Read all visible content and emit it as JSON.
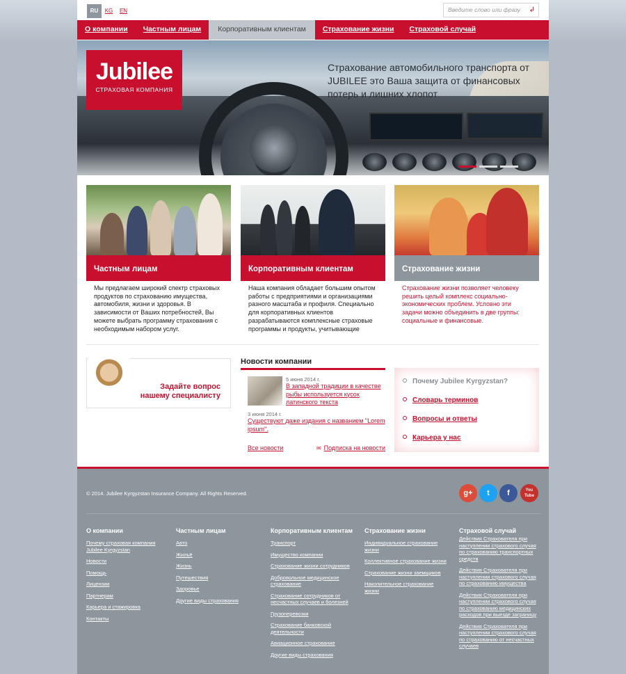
{
  "lang": {
    "ru": "RU",
    "kg": "KG",
    "en": "EN"
  },
  "search": {
    "placeholder": "Введите слово или фразу",
    "go": "↲"
  },
  "nav": [
    "О компании",
    "Частным лицам",
    "Корпоративным клиентам",
    "Страхование жизни",
    "Страховой случай"
  ],
  "banner": {
    "logo_word": "Jubilee",
    "logo_sub": "СТРАХОВАЯ КОМПАНИЯ",
    "slogan": "Страхование автомобильного транспорта от JUBILEE это Ваша защита от финансовых потерь и лишних хлопот"
  },
  "cards": [
    {
      "title": "Частным лицам",
      "text": "Мы предлагаем широкий спектр страховых продуктов по страхованию имущества, автомобиля, жизни и здоровья. В зависимости от Ваших потребностей, Вы можете выбрать программу страхования с необходимым набором услуг."
    },
    {
      "title": "Корпоративным клиентам",
      "text": "Наша компания обладает большим опытом работы с предприятиями и организациями разного масштаба и профиля. Специально для корпоративных клиентов разрабатываются комплексные страховые программы и продукты, учитывающие"
    },
    {
      "title": "Страхование жизни",
      "text": "Страхование жизни позволяет человеку решить целый комплекс социально-экономических проблем. Условно эти задачи можно объединить в две группы: социальные и финансовые."
    }
  ],
  "support": {
    "line1": "Задайте вопрос",
    "line2": "нашему специалисту"
  },
  "news": {
    "title": "Новости компании",
    "items": [
      {
        "date": "5 июня 2014 г.",
        "text": "В западной традиции в качестве рыбы используется кусок латинского текста"
      },
      {
        "date": "3 июня 2014 г.",
        "text": "Существуют даже издания с названием \"Lorem ipsum\"."
      }
    ],
    "all": "Все новости",
    "subscribe": "Подписка на новости"
  },
  "quicklinks": [
    "Почему Jubilee Kyrgyzstan?",
    "Словарь терминов",
    "Вопросы и ответы",
    "Карьера у нас"
  ],
  "footer": {
    "copyright": "© 2014. Jubilee Kyrgyzstan Insurance Company.  All Rights Reserved.",
    "social": [
      "g+",
      "t",
      "f",
      "You Tube"
    ],
    "columns": [
      {
        "title": "О компании",
        "links": [
          "Почему страховая компания Jubilee Kyrgyzstan",
          "Новости",
          "Помощь",
          "Лицензии",
          "Партнерам",
          "Карьера и стажировка",
          "Контакты"
        ]
      },
      {
        "title": "Частным лицам",
        "links": [
          "Авто",
          "Жильё",
          "Жизнь",
          "Путешествия",
          "Здоровье",
          "Другие виды страхования"
        ]
      },
      {
        "title": "Корпоративным клиентам",
        "links": [
          "Транспорт",
          "Имущество компании",
          "Страхование жизни сотрудников",
          "Добровольное медицинское страхование",
          "Страхование сотрудников от несчастных случаев и болезней",
          "Грузоперевозки",
          "Страхование банковской деятельности",
          "Авиационное страхование",
          "Другие виды страхования"
        ]
      },
      {
        "title": "Страхование жизни",
        "links": [
          "Индивидуальное страхование жизни",
          "Коллективное страхование жизни",
          "Страхование жизни заемщиков",
          "Накопительное страхование жизни"
        ]
      },
      {
        "title": "Страховой случай",
        "links": [
          "Действия Страхователя при наступлении страхового случая по страхованию транспортных средств",
          "Действия Страхователя при наступлении страхового случая по страхованию имущества",
          "Действия Страхователя при наступлении страхового случая по страхованию медицинских расходов при выезде заграницу",
          "Действия Страхователя при наступлении страхового случая по страхованию от несчастных случаев"
        ]
      }
    ]
  },
  "colors": {
    "brand": "#c8102e",
    "footer": "#8d959d",
    "nav_active": "#c1c6cc"
  }
}
